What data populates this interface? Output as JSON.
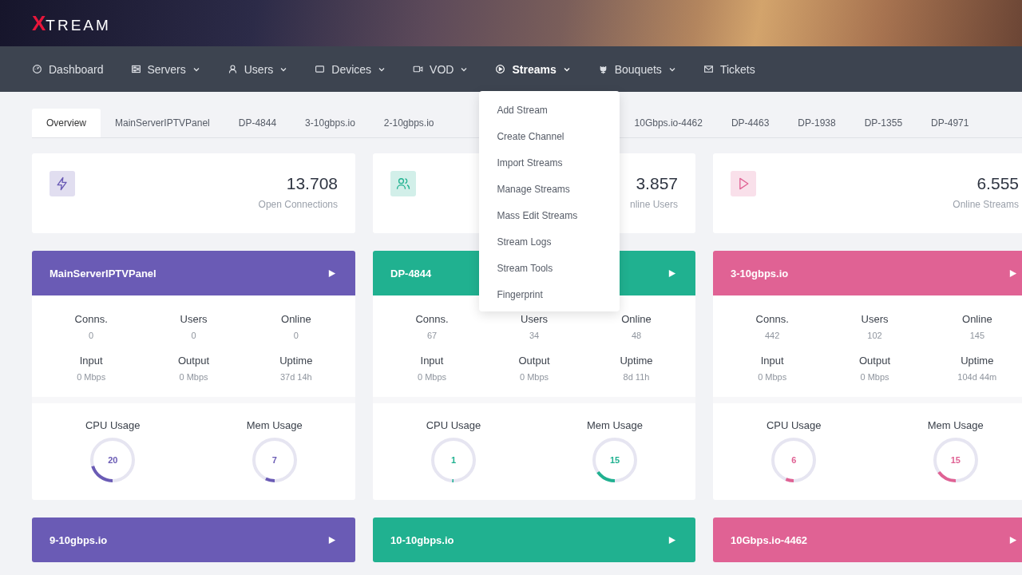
{
  "logo": {
    "mark": "X",
    "text": "TREAM"
  },
  "nav": [
    {
      "label": "Dashboard",
      "has_menu": false,
      "selected": false
    },
    {
      "label": "Servers",
      "has_menu": true,
      "selected": false
    },
    {
      "label": "Users",
      "has_menu": true,
      "selected": false
    },
    {
      "label": "Devices",
      "has_menu": true,
      "selected": false
    },
    {
      "label": "VOD",
      "has_menu": true,
      "selected": false
    },
    {
      "label": "Streams",
      "has_menu": true,
      "selected": true,
      "menu": [
        "Add Stream",
        "Create Channel",
        "Import Streams",
        "Manage Streams",
        "Mass Edit Streams",
        "Stream Logs",
        "Stream Tools",
        "Fingerprint"
      ]
    },
    {
      "label": "Bouquets",
      "has_menu": true,
      "selected": false
    },
    {
      "label": "Tickets",
      "has_menu": false,
      "selected": false
    }
  ],
  "tabs": [
    {
      "label": "Overview",
      "selected": true
    },
    {
      "label": "MainServerIPTVPanel",
      "selected": false
    },
    {
      "label": "DP-4844",
      "selected": false
    },
    {
      "label": "3-10gbps.io",
      "selected": false
    },
    {
      "label": "2-10gbps.io",
      "selected": false
    },
    {
      "label": "10Gbps.io-4462",
      "selected": false
    },
    {
      "label": "DP-4463",
      "selected": false
    },
    {
      "label": "DP-1938",
      "selected": false
    },
    {
      "label": "DP-1355",
      "selected": false
    },
    {
      "label": "DP-4971",
      "selected": false
    }
  ],
  "stats": [
    {
      "value": "13.708",
      "label": "Open Connections",
      "color": "#6a5bb5"
    },
    {
      "value": "3.857",
      "label": "nline Users",
      "color": "#20b190"
    },
    {
      "value": "6.555",
      "label": "Online Streams",
      "color": "#e06294"
    }
  ],
  "servers": [
    {
      "name": "MainServerIPTVPanel",
      "color": "#6a5bb5",
      "stats": [
        {
          "label": "Conns.",
          "value": "0"
        },
        {
          "label": "Users",
          "value": "0"
        },
        {
          "label": "Online",
          "value": "0"
        },
        {
          "label": "Input",
          "value": "0 Mbps"
        },
        {
          "label": "Output",
          "value": "0 Mbps"
        },
        {
          "label": "Uptime",
          "value": "37d 14h"
        }
      ],
      "usage": [
        {
          "label": "CPU Usage",
          "value": "20",
          "level": 0.2
        },
        {
          "label": "Mem Usage",
          "value": "7",
          "level": 0.07
        }
      ]
    },
    {
      "name": "DP-4844",
      "color": "#20b190",
      "stats": [
        {
          "label": "Conns.",
          "value": "67"
        },
        {
          "label": "Users",
          "value": "34"
        },
        {
          "label": "Online",
          "value": "48"
        },
        {
          "label": "Input",
          "value": "0 Mbps"
        },
        {
          "label": "Output",
          "value": "0 Mbps"
        },
        {
          "label": "Uptime",
          "value": "8d 11h"
        }
      ],
      "usage": [
        {
          "label": "CPU Usage",
          "value": "1",
          "level": 0.01
        },
        {
          "label": "Mem Usage",
          "value": "15",
          "level": 0.15
        }
      ]
    },
    {
      "name": "3-10gbps.io",
      "color": "#e06294",
      "stats": [
        {
          "label": "Conns.",
          "value": "442"
        },
        {
          "label": "Users",
          "value": "102"
        },
        {
          "label": "Online",
          "value": "145"
        },
        {
          "label": "Input",
          "value": "0 Mbps"
        },
        {
          "label": "Output",
          "value": "0 Mbps"
        },
        {
          "label": "Uptime",
          "value": "104d 44m"
        }
      ],
      "usage": [
        {
          "label": "CPU Usage",
          "value": "6",
          "level": 0.06
        },
        {
          "label": "Mem Usage",
          "value": "15",
          "level": 0.15
        }
      ]
    },
    {
      "name": "9-10gbps.io",
      "color": "#6a5bb5"
    },
    {
      "name": "10-10gbps.io",
      "color": "#20b190"
    },
    {
      "name": "10Gbps.io-4462",
      "color": "#e06294"
    }
  ]
}
